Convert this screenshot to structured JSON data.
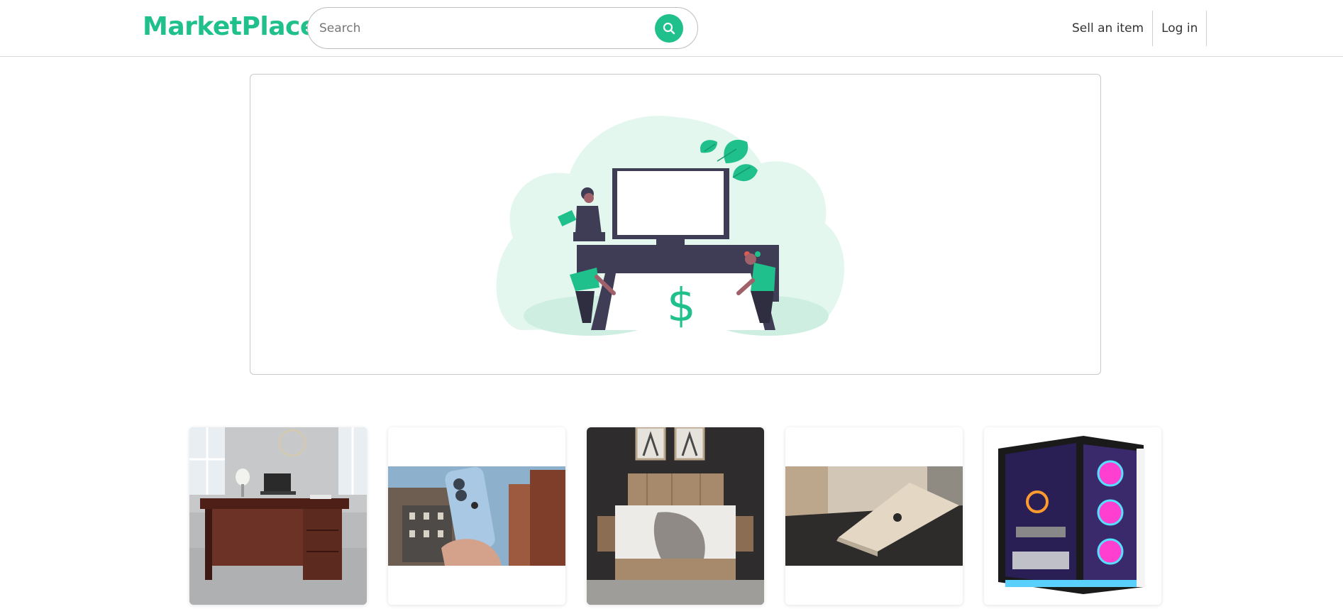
{
  "brand": {
    "name": "MarketPlace",
    "color": "#1fc08b"
  },
  "search": {
    "placeholder": "Search",
    "value": "",
    "button_icon": "search-icon"
  },
  "nav": {
    "sell_label": "Sell an item",
    "login_label": "Log in"
  },
  "hero": {
    "illustration": "people-carrying-desk-dollar-illustration",
    "price_symbol": "$"
  },
  "products": [
    {
      "name": "office-desk",
      "icon": "desk-photo"
    },
    {
      "name": "iphone",
      "icon": "phone-photo"
    },
    {
      "name": "bed",
      "icon": "bed-photo"
    },
    {
      "name": "laptop",
      "icon": "laptop-photo"
    },
    {
      "name": "gaming-pc",
      "icon": "pc-photo"
    }
  ],
  "colors": {
    "accent": "#1fc08b",
    "accent_light": "#e3f7ef",
    "dark": "#3f3d56"
  }
}
